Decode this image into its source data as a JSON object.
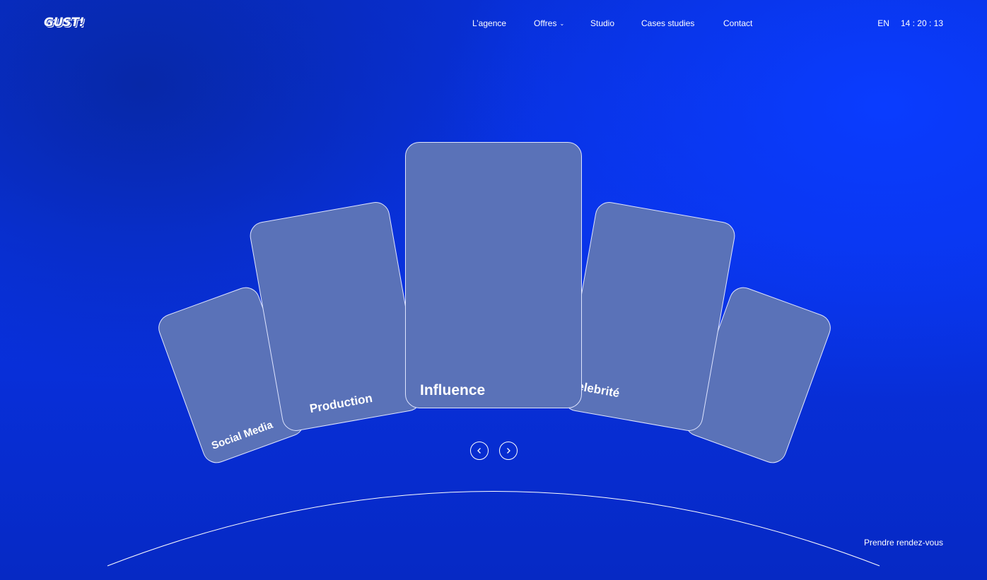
{
  "brand": {
    "logo_text": "GUST!"
  },
  "nav": {
    "items": [
      {
        "label": "L’agence"
      },
      {
        "label": "Offres",
        "has_dropdown": true
      },
      {
        "label": "Studio"
      },
      {
        "label": "Cases studies"
      },
      {
        "label": "Contact"
      }
    ]
  },
  "header": {
    "lang": "EN",
    "clock": "14 : 20 : 13"
  },
  "carousel": {
    "cards": [
      {
        "label": "Social Media"
      },
      {
        "label": "Production"
      },
      {
        "label": "Influence"
      },
      {
        "label": "Celebrité"
      },
      {
        "label": ""
      }
    ],
    "prev_icon": "chevron-left-icon",
    "next_icon": "chevron-right-icon"
  },
  "cta": {
    "label": "Prendre rendez-vous"
  },
  "colors": {
    "background": "#0933e6",
    "card_fill": "#5a72b8",
    "card_border": "#dfe5ff",
    "text": "#ffffff"
  }
}
